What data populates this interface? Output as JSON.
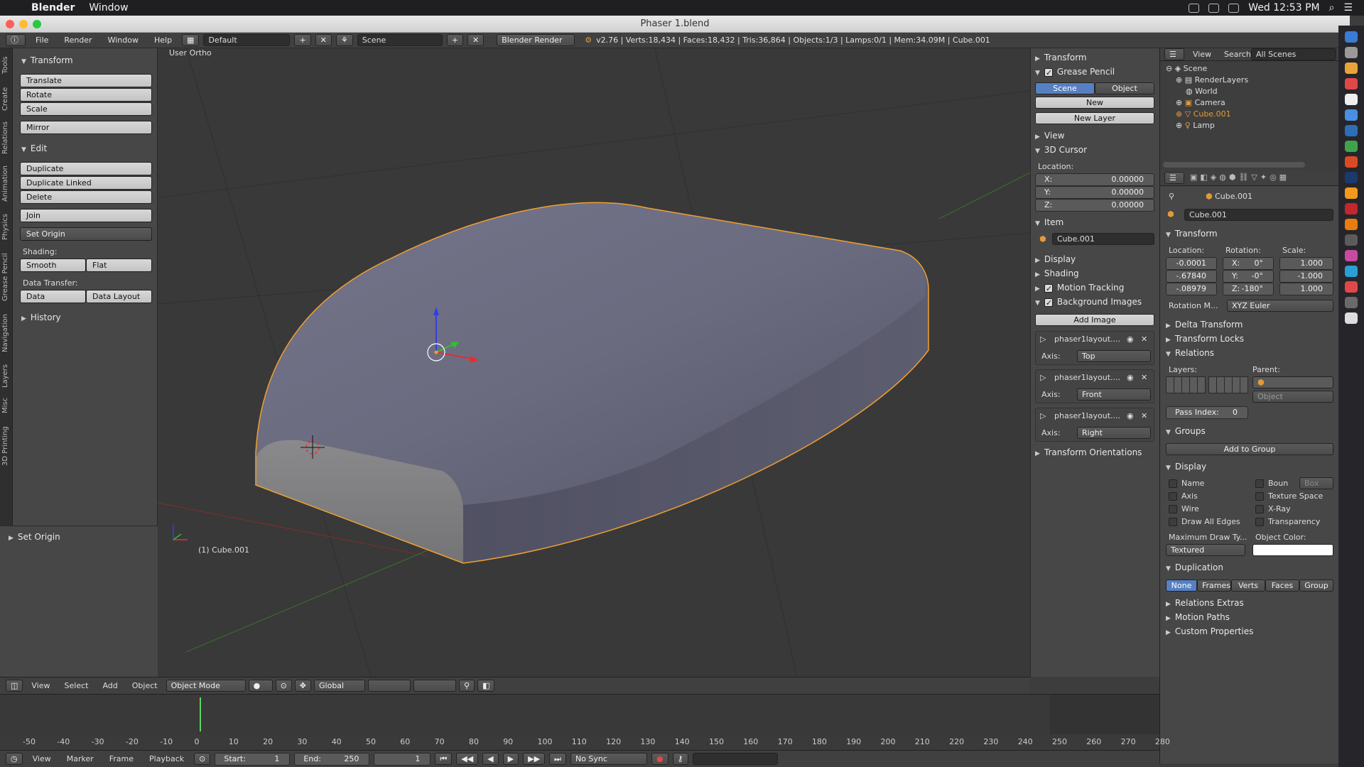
{
  "macbar": {
    "app": "Blender",
    "menu": "Window",
    "clock": "Wed 12:53 PM"
  },
  "window": {
    "title": "Phaser 1.blend"
  },
  "info": {
    "menus": [
      "File",
      "Render",
      "Window",
      "Help"
    ],
    "layout": "Default",
    "scene": "Scene",
    "engine": "Blender Render",
    "stats": "v2.76 | Verts:18,434 | Faces:18,432 | Tris:36,864 | Objects:1/3 | Lamps:0/1 | Mem:34.09M | Cube.001"
  },
  "tabs": [
    "Tools",
    "Create",
    "Relations",
    "Animation",
    "Physics",
    "Grease Pencil",
    "Navigation",
    "Layers",
    "Misc",
    "3D Printing"
  ],
  "tools": {
    "transform_hdr": "Transform",
    "translate": "Translate",
    "rotate": "Rotate",
    "scale": "Scale",
    "mirror": "Mirror",
    "edit_hdr": "Edit",
    "duplicate": "Duplicate",
    "duplicate_linked": "Duplicate Linked",
    "delete": "Delete",
    "join": "Join",
    "set_origin": "Set Origin",
    "shading": "Shading:",
    "smooth": "Smooth",
    "flat": "Flat",
    "data_transfer": "Data Transfer:",
    "data": "Data",
    "data_layout": "Data Layout",
    "history": "History"
  },
  "redo": {
    "title": "Set Origin"
  },
  "viewport": {
    "view_name": "User Ortho",
    "object_label": "(1) Cube.001"
  },
  "vpheader": {
    "view": "View",
    "select": "Select",
    "add": "Add",
    "object": "Object",
    "mode": "Object Mode",
    "orientation": "Global"
  },
  "npanel": {
    "transform": "Transform",
    "grease_pencil": "Grease Pencil",
    "scene": "Scene",
    "object": "Object",
    "new": "New",
    "new_layer": "New Layer",
    "view": "View",
    "cursor": "3D Cursor",
    "location": "Location:",
    "x_label": "X:",
    "y_label": "Y:",
    "z_label": "Z:",
    "x": "0.00000",
    "y": "0.00000",
    "z": "0.00000",
    "item": "Item",
    "item_name": "Cube.001",
    "display": "Display",
    "shading": "Shading",
    "motion_tracking": "Motion Tracking",
    "bg_images": "Background Images",
    "add_image": "Add Image",
    "axis_label": "Axis:",
    "bg": [
      {
        "name": "phaser1layout....",
        "axis": "Top"
      },
      {
        "name": "phaser1layout....",
        "axis": "Front"
      },
      {
        "name": "phaser1layout....",
        "axis": "Right"
      }
    ],
    "transform_orient": "Transform Orientations"
  },
  "outliner": {
    "view": "View",
    "search": "Search",
    "scenes": "All Scenes",
    "items": [
      "Scene",
      "RenderLayers",
      "World",
      "Camera",
      "Cube.001",
      "Lamp"
    ]
  },
  "props": {
    "crumb": "Cube.001",
    "name": "Cube.001",
    "transform": "Transform",
    "location": "Location:",
    "rotation": "Rotation:",
    "scale": "Scale:",
    "loc": [
      "-0.0001",
      "-.67840",
      "-.08979"
    ],
    "rot_axes": [
      "X:",
      "Y:",
      "Z:"
    ],
    "rot": [
      "0°",
      "-0°",
      "-180°"
    ],
    "scl": [
      "1.000",
      "-1.000",
      "1.000"
    ],
    "rot_mode_label": "Rotation M...",
    "rot_mode": "XYZ Euler",
    "delta": "Delta Transform",
    "locks": "Transform Locks",
    "relations": "Relations",
    "layers": "Layers:",
    "parent": "Parent:",
    "parent_type": "Object",
    "pass_index": "Pass Index:",
    "pass_val": "0",
    "groups": "Groups",
    "add_group": "Add to Group",
    "display": "Display",
    "name_lbl": "Name",
    "bounds": "Boun",
    "box": "Box",
    "axis": "Axis",
    "texspace": "Texture Space",
    "wire": "Wire",
    "xray": "X-Ray",
    "draw_edges": "Draw All Edges",
    "transparency": "Transparency",
    "max_draw": "Maximum Draw Ty...",
    "obj_color": "Object Color:",
    "textured": "Textured",
    "duplication": "Duplication",
    "dup_opts": [
      "None",
      "Frames",
      "Verts",
      "Faces",
      "Group"
    ],
    "rel_extras": "Relations Extras",
    "motion_paths": "Motion Paths",
    "custom": "Custom Properties"
  },
  "timeline": {
    "ticks": [
      "-50",
      "-40",
      "-30",
      "-20",
      "-10",
      "0",
      "10",
      "20",
      "30",
      "40",
      "50",
      "60",
      "70",
      "80",
      "90",
      "100",
      "110",
      "120",
      "130",
      "140",
      "150",
      "160",
      "170",
      "180",
      "190",
      "200",
      "210",
      "220",
      "230",
      "240",
      "250",
      "260",
      "270",
      "280"
    ],
    "view": "View",
    "marker": "Marker",
    "frame": "Frame",
    "playback": "Playback",
    "start_label": "Start:",
    "start": "1",
    "end_label": "End:",
    "end": "250",
    "current": "1",
    "sync": "No Sync"
  }
}
